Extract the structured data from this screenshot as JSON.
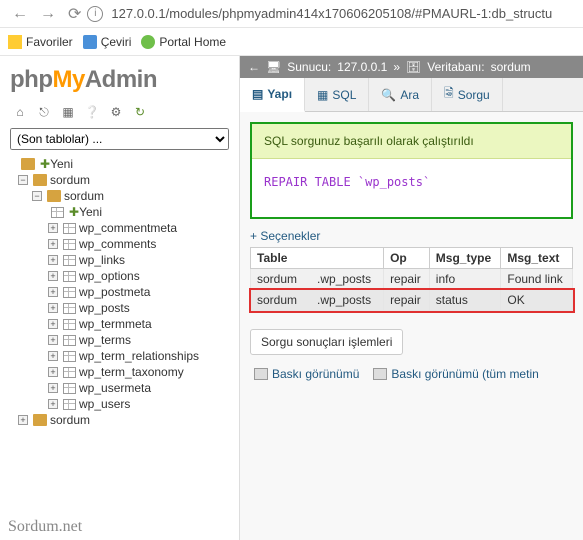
{
  "browser": {
    "url": "127.0.0.1/modules/phpmyadmin414x170606205108/#PMAURL-1:db_structu"
  },
  "bookmarks": {
    "fav": "Favoriler",
    "ceviri": "Çeviri",
    "portal": "Portal Home"
  },
  "logo": {
    "php": "php",
    "my": "My",
    "admin": "Admin"
  },
  "recent": {
    "label": "(Son tablolar) ..."
  },
  "tree": {
    "yeni": "Yeni",
    "db": "sordum",
    "sub_sordum": "sordum",
    "sub_yeni": "Yeni",
    "tables": [
      "wp_commentmeta",
      "wp_comments",
      "wp_links",
      "wp_options",
      "wp_postmeta",
      "wp_posts",
      "wp_termmeta",
      "wp_terms",
      "wp_term_relationships",
      "wp_term_taxonomy",
      "wp_usermeta",
      "wp_users"
    ],
    "bottom_sordum": "sordum"
  },
  "watermark": "Sordum.net",
  "breadcrumb": {
    "server_label": "Sunucu:",
    "server_value": "127.0.0.1",
    "sep": "»",
    "db_label": "Veritabanı:",
    "db_value": "sordum"
  },
  "tabs": {
    "yapi": "Yapı",
    "sql": "SQL",
    "ara": "Ara",
    "sorgu": "Sorgu"
  },
  "success": "SQL sorgunuz başarılı olarak çalıştırıldı",
  "sql": {
    "stmt": "REPAIR TABLE `wp_posts`"
  },
  "options": "+ Seçenekler",
  "table": {
    "headers": [
      "Table",
      "Op",
      "Msg_type",
      "Msg_text"
    ],
    "rows": [
      {
        "table_prefix": "sordum",
        "table": "wp_posts",
        "op": "repair",
        "type": "info",
        "text": "Found link"
      },
      {
        "table_prefix": "sordum",
        "table": "wp_posts",
        "op": "repair",
        "type": "status",
        "text": "OK"
      }
    ]
  },
  "results_ops": {
    "label": "Sorgu sonuçları işlemleri",
    "print_view": "Baskı görünümü",
    "print_view_full": "Baskı görünümü (tüm metin"
  }
}
